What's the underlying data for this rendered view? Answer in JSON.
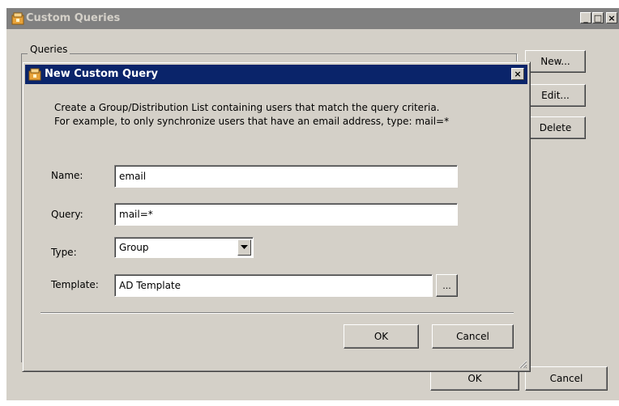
{
  "parent_window": {
    "title": "Custom Queries",
    "icon": "app-icon",
    "minimize_label": "_",
    "maximize_label": "□",
    "close_label": "×",
    "groupbox_label": "Queries",
    "buttons": {
      "new": "New...",
      "edit": "Edit...",
      "delete": "Delete"
    },
    "footer": {
      "ok": "OK",
      "cancel": "Cancel"
    }
  },
  "dialog": {
    "title": "New Custom Query",
    "icon": "app-icon",
    "close_label": "×",
    "description_line1": "Create a Group/Distribution List containing users that match the query criteria.",
    "description_line2": "For example, to only synchronize users that have an email address, type: mail=*",
    "fields": {
      "name": {
        "label": "Name:",
        "value": "email"
      },
      "query": {
        "label": "Query:",
        "value": "mail=*"
      },
      "type": {
        "label": "Type:",
        "value": "Group"
      },
      "template": {
        "label": "Template:",
        "value": "AD Template",
        "browse_label": "..."
      }
    },
    "ok_label": "OK",
    "cancel_label": "Cancel"
  },
  "colors": {
    "dialog_titlebar": "#0a246a",
    "inactive_titlebar": "#808080",
    "face": "#d4d0c8"
  }
}
